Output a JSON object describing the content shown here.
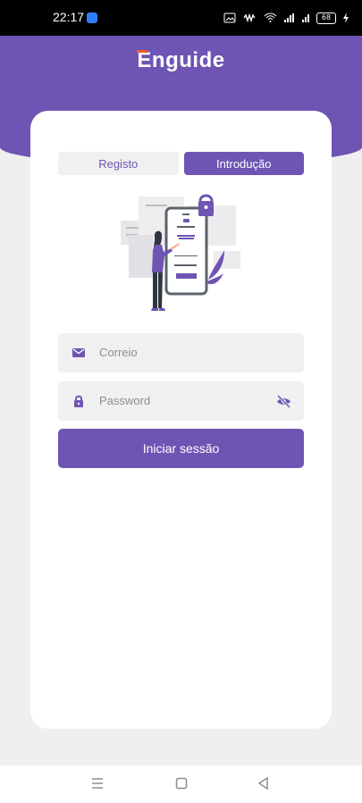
{
  "status_bar": {
    "time": "22:17",
    "battery": "68"
  },
  "app": {
    "brand_name": "Enguide",
    "accent_color": "#6e55b3",
    "brand_accent_color": "#e85b2a"
  },
  "auth": {
    "tabs": [
      {
        "label": "Registo",
        "active": false
      },
      {
        "label": "Introdução",
        "active": true
      }
    ],
    "email_placeholder": "Correio",
    "password_placeholder": "Password",
    "login_button": "Iniciar sessão",
    "icons": {
      "email": "mail-icon",
      "password": "lock-icon",
      "visibility": "eye-off-icon"
    }
  },
  "navigation": {
    "menu": "menu-icon",
    "home": "square-icon",
    "back": "back-icon"
  }
}
